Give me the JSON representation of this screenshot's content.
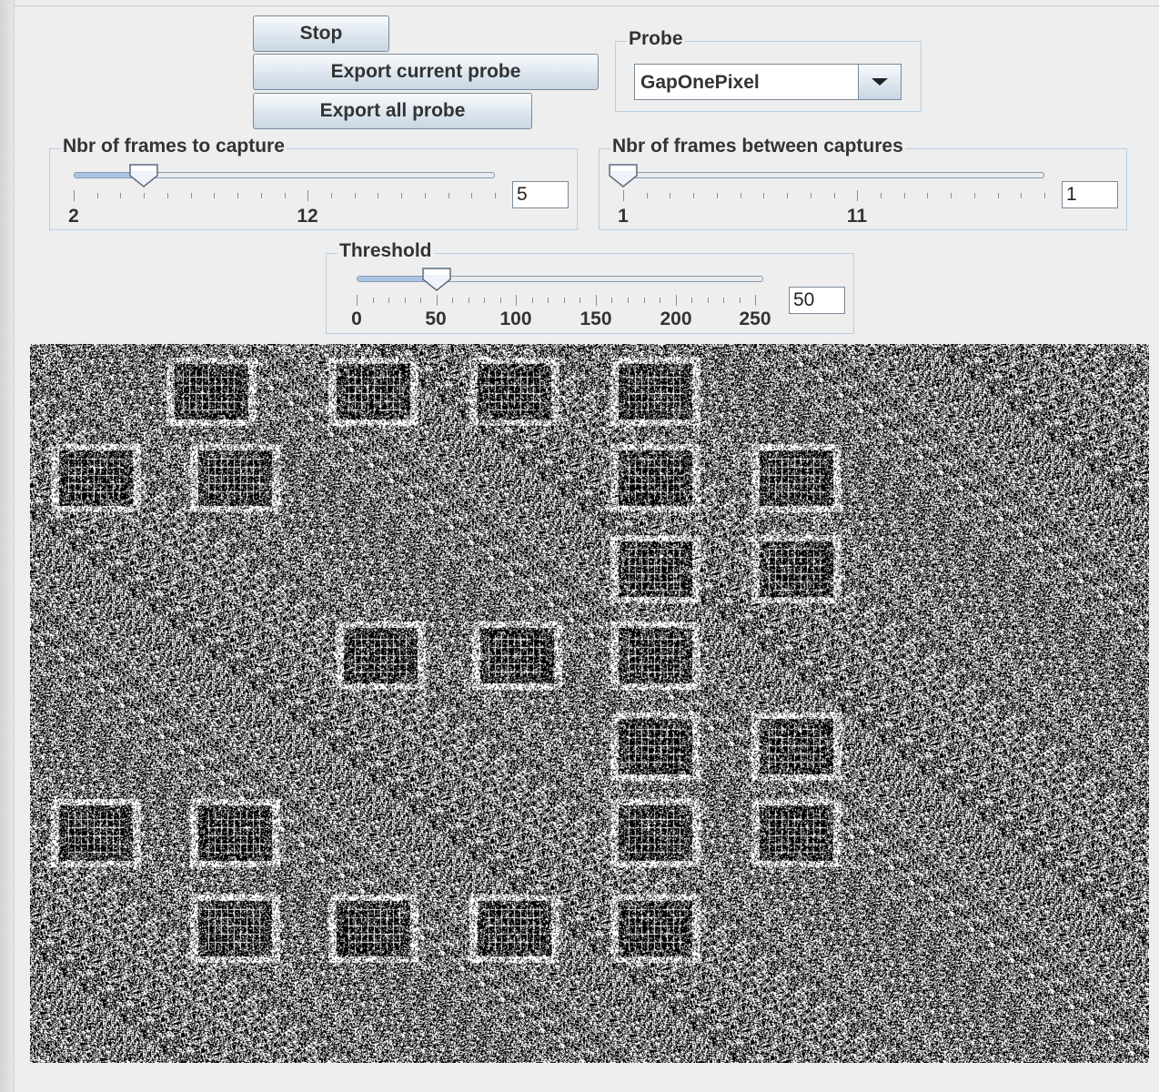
{
  "buttons": {
    "stop": "Stop",
    "export_current": "Export current probe",
    "export_all": "Export all probe"
  },
  "probe": {
    "title": "Probe",
    "selected": "GapOnePixel"
  },
  "sliders": [
    {
      "title": "Nbr of frames to capture",
      "min": 2,
      "max": 20,
      "value": 5,
      "field": "5",
      "labels": [
        "2",
        "12"
      ]
    },
    {
      "title": "Nbr of frames between captures",
      "min": 1,
      "max": 19,
      "value": 1,
      "field": "1",
      "labels": [
        "1",
        "11"
      ]
    },
    {
      "title": "Threshold",
      "min": 0,
      "max": 255,
      "value": 50,
      "field": "50",
      "labels": [
        "0",
        "50",
        "100",
        "150",
        "200",
        "250"
      ]
    }
  ],
  "colors": {
    "panel_bg": "#eeeeee",
    "border": "#b8cfe5",
    "slider_fill": "#aac4e3"
  }
}
